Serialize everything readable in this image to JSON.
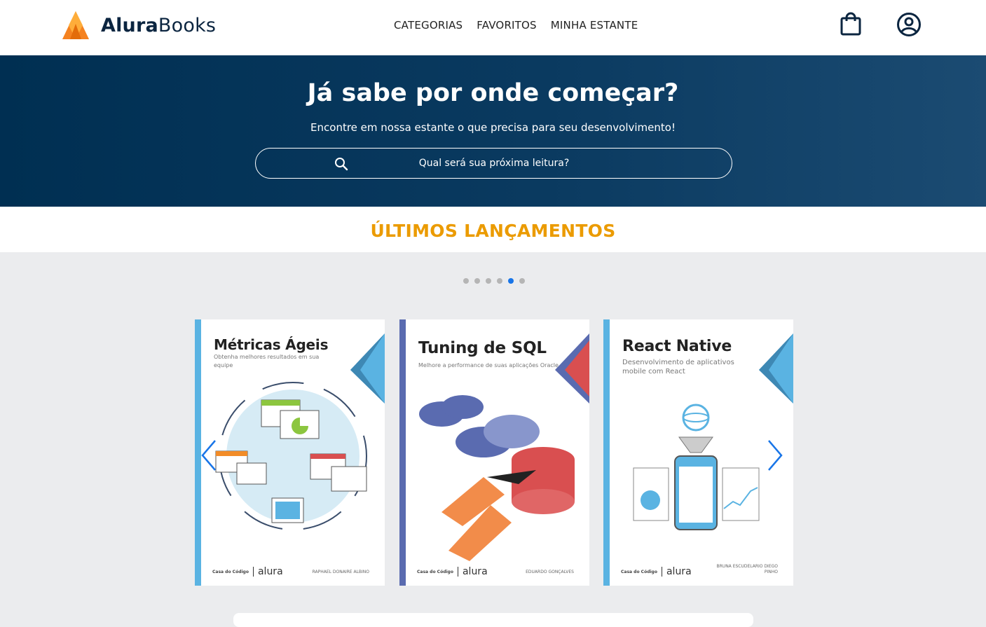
{
  "brand": {
    "name_bold": "Alura",
    "name_regular": "Books",
    "color_orange": "#f58220",
    "color_dark": "#0b2540"
  },
  "nav": {
    "items": [
      "CATEGORIAS",
      "FAVORITOS",
      "MINHA ESTANTE"
    ]
  },
  "icons": {
    "cart": "shopping-bag-icon",
    "user": "user-circle-icon",
    "search": "search-icon"
  },
  "banner": {
    "title": "Já sabe por onde começar?",
    "subtitle": "Encontre em nossa estante o que precisa para seu desenvolvimento!",
    "search_placeholder": "Qual será sua próxima leitura?"
  },
  "releases": {
    "title": "ÚLTIMOS LANÇAMENTOS",
    "accent": "#eb9b00",
    "dots_total": 6,
    "dots_active_index": 4,
    "books": [
      {
        "title": "Métricas Ágeis",
        "subtitle": "Obtenha melhores resultados em sua equipe",
        "publisher_left": "Casa do Código",
        "publisher_right": "alura",
        "author": "RAPHAEL DONAIRE ALBINO",
        "spine_color": "#5ab3e2",
        "corner_color": "#5ab3e2"
      },
      {
        "title": "Tuning de SQL",
        "subtitle": "Melhore a performance de suas aplicações Oracle",
        "publisher_left": "Casa do Código",
        "publisher_right": "alura",
        "author": "EDUARDO GONÇALVES",
        "spine_color": "#5a6bb0",
        "corner_color": "#d94f50"
      },
      {
        "title": "React Native",
        "subtitle": "Desenvolvimento de aplicativos mobile com React",
        "publisher_left": "Casa do Código",
        "publisher_right": "alura",
        "author": "BRUNA ESCUDELARIO DIEGO PINHO",
        "spine_color": "#5ab3e2",
        "corner_color": "#5ab3e2"
      }
    ]
  }
}
